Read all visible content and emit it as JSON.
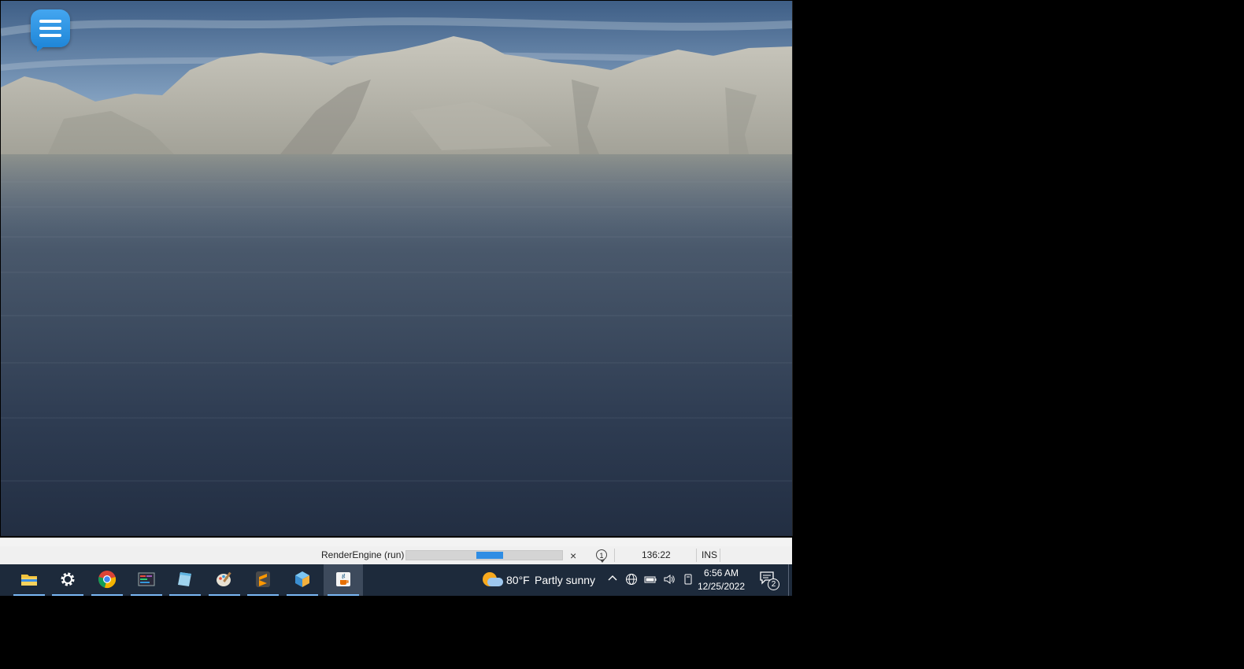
{
  "app": {
    "menu_icon": "hamburger-menu-icon",
    "accent_color": "#2f8de4"
  },
  "status_bar": {
    "task_label": "RenderEngine (run)",
    "progress_fraction": 0.17,
    "progress_offset_fraction": 0.45,
    "cancel_label": "×",
    "notifications": "1",
    "caret_position": "136:22",
    "insert_mode": "INS"
  },
  "taskbar": {
    "apps": [
      {
        "name": "File Explorer",
        "icon": "folder-icon"
      },
      {
        "name": "Settings",
        "icon": "gear-icon"
      },
      {
        "name": "Google Chrome",
        "icon": "chrome-icon"
      },
      {
        "name": "Terminal",
        "icon": "terminal-icon"
      },
      {
        "name": "Notepad",
        "icon": "notepad-icon"
      },
      {
        "name": "Paint",
        "icon": "paint-palette-icon"
      },
      {
        "name": "Sublime Text",
        "icon": "sublime-text-icon"
      },
      {
        "name": "NetBeans",
        "icon": "netbeans-cube-icon"
      },
      {
        "name": "Java",
        "icon": "java-cup-icon"
      }
    ],
    "active_app_index": 8,
    "weather": {
      "temperature": "80°F",
      "condition": "Partly sunny"
    },
    "tray": {
      "icons": [
        "chevron-up-icon",
        "globe-network-icon",
        "battery-icon",
        "speaker-icon",
        "pen-input-icon"
      ]
    },
    "clock": {
      "time": "6:56 AM",
      "date": "12/25/2022"
    },
    "action_center": {
      "count": "2"
    }
  }
}
